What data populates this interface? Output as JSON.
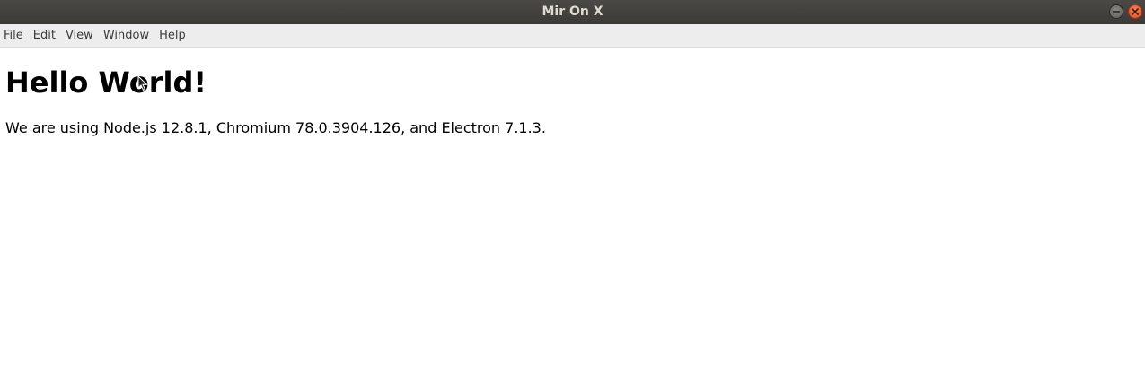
{
  "window": {
    "title": "Mir On X",
    "controls": {
      "minimize_icon": "minimize-icon",
      "close_icon": "close-icon"
    },
    "accent_close": "#e0451b"
  },
  "menubar": {
    "items": [
      {
        "label": "File"
      },
      {
        "label": "Edit"
      },
      {
        "label": "View"
      },
      {
        "label": "Window"
      },
      {
        "label": "Help"
      }
    ]
  },
  "content": {
    "heading": "Hello World!",
    "paragraph": "We are using Node.js 12.8.1, Chromium 78.0.3904.126, and Electron 7.1.3."
  }
}
